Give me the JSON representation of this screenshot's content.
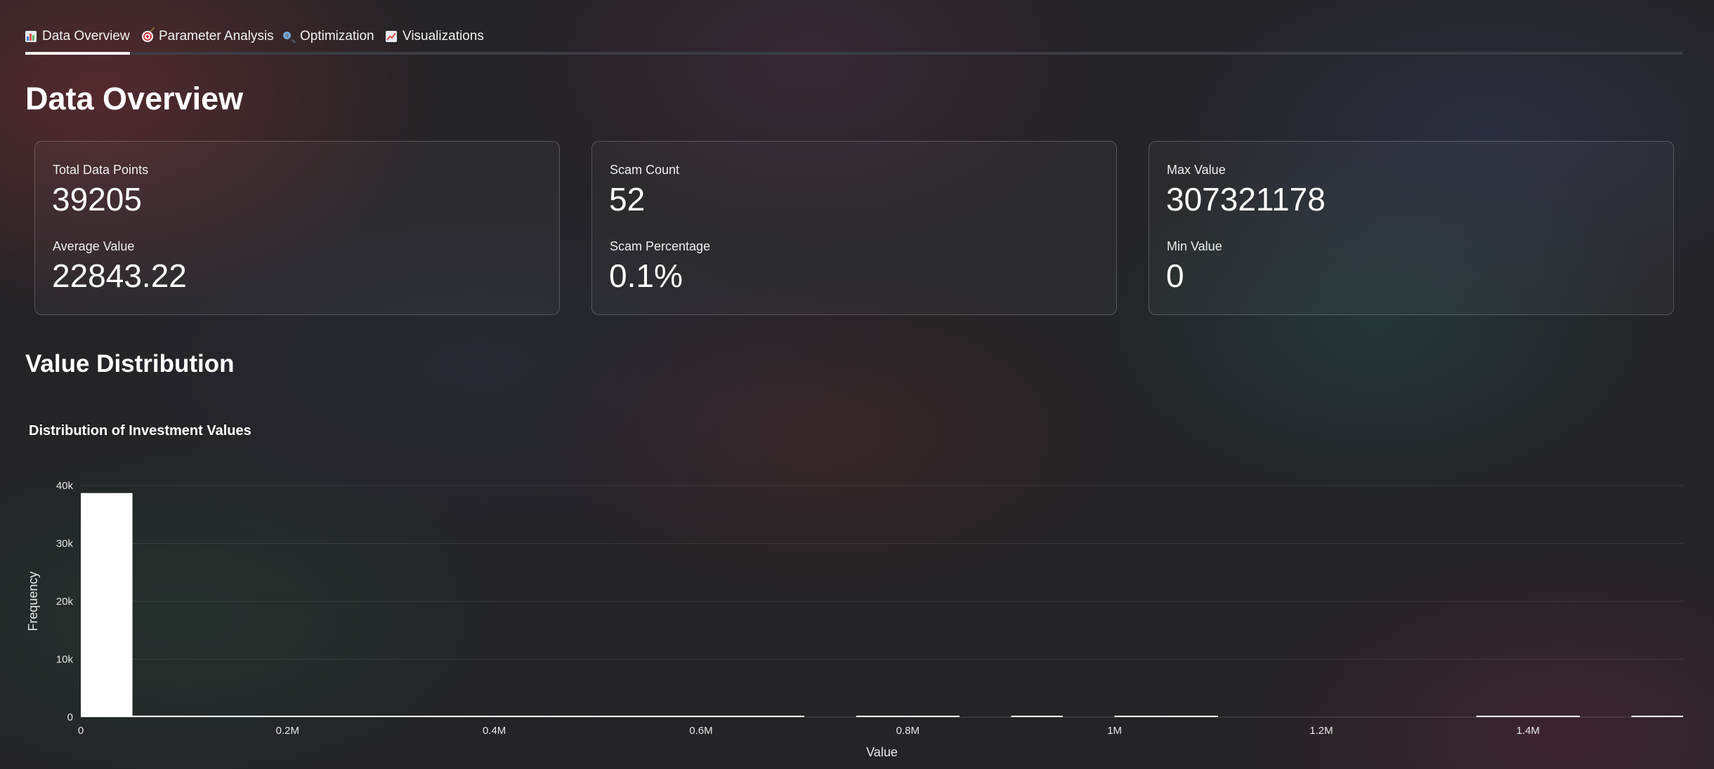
{
  "tabs": [
    {
      "label": "Data Overview",
      "icon": "bar-chart-icon",
      "active": true
    },
    {
      "label": "Parameter Analysis",
      "icon": "target-icon",
      "active": false
    },
    {
      "label": "Optimization",
      "icon": "search-icon",
      "active": false
    },
    {
      "label": "Visualizations",
      "icon": "trend-chart-icon",
      "active": false
    }
  ],
  "page_title": "Data Overview",
  "cards": [
    {
      "stats": [
        {
          "label": "Total Data Points",
          "value": "39205"
        },
        {
          "label": "Average Value",
          "value": "22843.22"
        }
      ]
    },
    {
      "stats": [
        {
          "label": "Scam Count",
          "value": "52"
        },
        {
          "label": "Scam Percentage",
          "value": "0.1%"
        }
      ]
    },
    {
      "stats": [
        {
          "label": "Max Value",
          "value": "307321178"
        },
        {
          "label": "Min Value",
          "value": "0"
        }
      ]
    }
  ],
  "section_title": "Value Distribution",
  "chart_data": {
    "type": "bar",
    "title": "Distribution of Investment Values",
    "xlabel": "Value",
    "ylabel": "Frequency",
    "xlim": [
      0,
      1550000
    ],
    "ylim": [
      0,
      40000
    ],
    "bin_width": 50000,
    "x_ticks": [
      {
        "value": 0,
        "label": "0"
      },
      {
        "value": 200000,
        "label": "0.2M"
      },
      {
        "value": 400000,
        "label": "0.4M"
      },
      {
        "value": 600000,
        "label": "0.6M"
      },
      {
        "value": 800000,
        "label": "0.8M"
      },
      {
        "value": 1000000,
        "label": "1M"
      },
      {
        "value": 1200000,
        "label": "1.2M"
      },
      {
        "value": 1400000,
        "label": "1.4M"
      }
    ],
    "y_ticks": [
      {
        "value": 0,
        "label": "0"
      },
      {
        "value": 10000,
        "label": "10k"
      },
      {
        "value": 20000,
        "label": "20k"
      },
      {
        "value": 30000,
        "label": "30k"
      },
      {
        "value": 40000,
        "label": "40k"
      }
    ],
    "bins": [
      {
        "x0": 0,
        "x1": 50000,
        "count": 38700
      },
      {
        "x0": 50000,
        "x1": 100000,
        "count": 250
      },
      {
        "x0": 100000,
        "x1": 150000,
        "count": 90
      },
      {
        "x0": 150000,
        "x1": 200000,
        "count": 50
      },
      {
        "x0": 200000,
        "x1": 250000,
        "count": 30
      },
      {
        "x0": 250000,
        "x1": 300000,
        "count": 20
      },
      {
        "x0": 300000,
        "x1": 350000,
        "count": 15
      },
      {
        "x0": 350000,
        "x1": 400000,
        "count": 10
      },
      {
        "x0": 400000,
        "x1": 450000,
        "count": 8
      },
      {
        "x0": 450000,
        "x1": 500000,
        "count": 6
      },
      {
        "x0": 500000,
        "x1": 550000,
        "count": 5
      },
      {
        "x0": 550000,
        "x1": 600000,
        "count": 4
      },
      {
        "x0": 600000,
        "x1": 650000,
        "count": 3
      },
      {
        "x0": 650000,
        "x1": 700000,
        "count": 2
      },
      {
        "x0": 750000,
        "x1": 800000,
        "count": 2
      },
      {
        "x0": 800000,
        "x1": 850000,
        "count": 2
      },
      {
        "x0": 900000,
        "x1": 950000,
        "count": 2
      },
      {
        "x0": 1000000,
        "x1": 1050000,
        "count": 2
      },
      {
        "x0": 1050000,
        "x1": 1100000,
        "count": 1
      },
      {
        "x0": 1350000,
        "x1": 1400000,
        "count": 1
      },
      {
        "x0": 1400000,
        "x1": 1450000,
        "count": 1
      },
      {
        "x0": 1500000,
        "x1": 1550000,
        "count": 2
      }
    ],
    "bar_color": "#ffffff",
    "grid": true
  }
}
